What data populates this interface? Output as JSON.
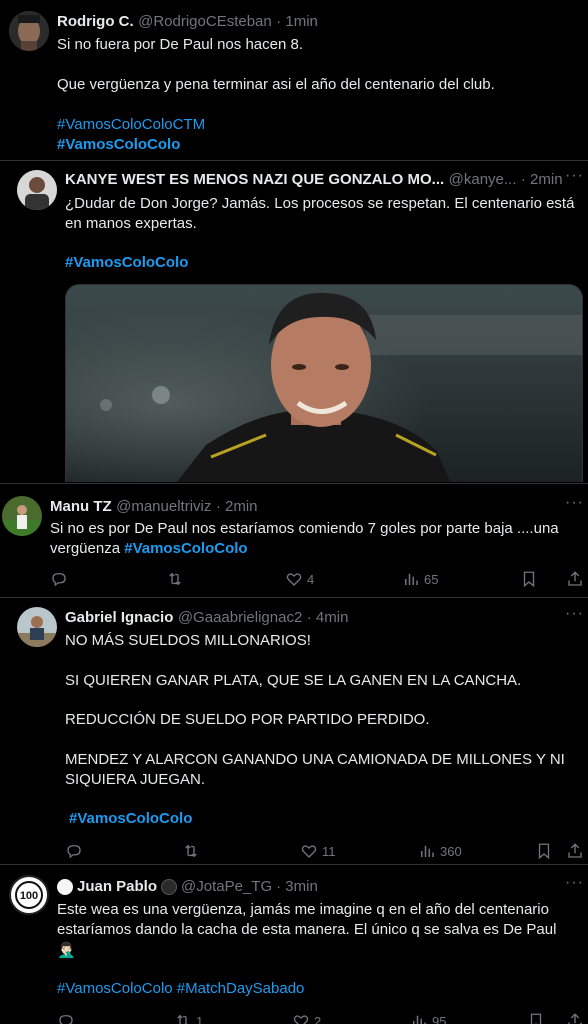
{
  "colors": {
    "bg": "#000000",
    "text": "#e7e9ea",
    "muted": "#71767b",
    "accent": "#1d9bf0",
    "divider": "#2f3336"
  },
  "tweet1": {
    "name": "Rodrigo C.",
    "handle": "@RodrigoCEsteban",
    "time": "· 1min",
    "line1": "Si no fuera por De Paul nos hacen 8.",
    "line2": "Que vergüenza y pena terminar asi el año del centenario del club.",
    "hashtag1": "#VamosColoColoCTM",
    "hashtag2": "#VamosColoColo"
  },
  "tweet2": {
    "name": "KANYE WEST ES MENOS NAZI QUE GONZALO MO...",
    "handle": "@kanye...",
    "time": "· 2min",
    "line1": "¿Dudar de Don Jorge? Jamás. Los procesos se respetan. El centenario está",
    "line2": "en manos expertas.",
    "hashtag": "#VamosColoColo",
    "media_icon": "photo-of-smiling-coach"
  },
  "tweet3": {
    "name": "Manu TZ",
    "handle": "@manueltriviz",
    "time": "· 2min",
    "line1": "Si no es por De Paul nos estaríamos comiendo 7 goles por parte baja ....una",
    "line2_text": "vergüenza",
    "line2_tag": "#VamosColoColo",
    "retweets": "",
    "likes": "4",
    "views": "65"
  },
  "tweet4": {
    "name": "Gabriel Ignacio",
    "handle": "@Gaaabrielignac2",
    "time": "· 4min",
    "p1": "NO MÁS SUELDOS MILLONARIOS!",
    "p2": "SI QUIEREN GANAR PLATA, QUE SE LA GANEN EN LA CANCHA.",
    "p3": "REDUCCIÓN DE SUELDO POR PARTIDO PERDIDO.",
    "p4a": "MENDEZ Y ALARCON GANANDO UNA CAMIONADA DE MILLONES Y NI",
    "p4b": "SIQUIERA JUEGAN.",
    "hashtag": "#VamosColoColo",
    "retweets": "",
    "likes": "11",
    "views": "360"
  },
  "tweet5": {
    "name": "Juan Pablo",
    "handle": "@JotaPe_TG",
    "time": "· 3min",
    "avatar_text": "100",
    "line1": "Este wea es una vergüenza, jamás me imagine q en el año del centenario",
    "line2": "estaríamos dando la cacha de esta manera. El único q se salva es De Paul",
    "emoji": "🤦🏻‍♂️",
    "hashtag1": "#VamosColoColo",
    "hashtag2": "#MatchDaySabado",
    "retweets": "1",
    "likes": "2",
    "views": "95"
  }
}
